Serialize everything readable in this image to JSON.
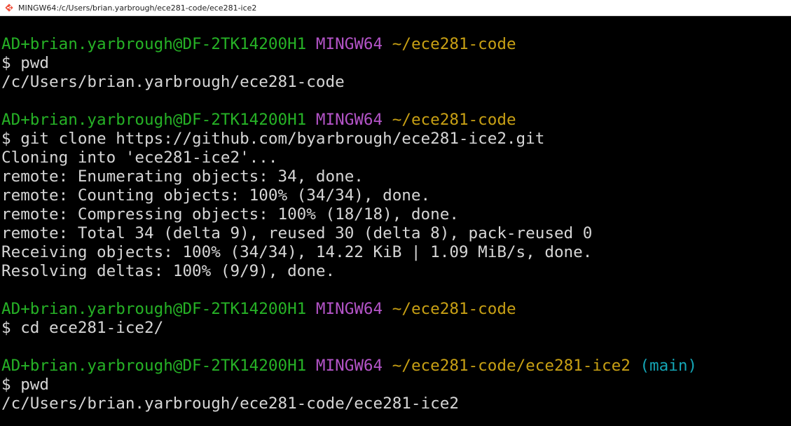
{
  "window": {
    "title": "MINGW64:/c/Users/brian.yarbrough/ece281-code/ece281-ice2",
    "icon": "git-bash-icon"
  },
  "colors": {
    "background": "#000000",
    "text": "#d6d6d6",
    "user_host": "#26b226",
    "shell": "#b454c8",
    "path": "#c8a014",
    "branch": "#14a4b4"
  },
  "terminal": {
    "blocks": [
      {
        "prompt": {
          "user_host": "AD+brian.yarbrough@DF-2TK14200H1",
          "shell": "MINGW64",
          "path": "~/ece281-code",
          "branch": ""
        },
        "command": "$ pwd",
        "output": [
          "/c/Users/brian.yarbrough/ece281-code"
        ]
      },
      {
        "prompt": {
          "user_host": "AD+brian.yarbrough@DF-2TK14200H1",
          "shell": "MINGW64",
          "path": "~/ece281-code",
          "branch": ""
        },
        "command": "$ git clone https://github.com/byarbrough/ece281-ice2.git",
        "output": [
          "Cloning into 'ece281-ice2'...",
          "remote: Enumerating objects: 34, done.",
          "remote: Counting objects: 100% (34/34), done.",
          "remote: Compressing objects: 100% (18/18), done.",
          "remote: Total 34 (delta 9), reused 30 (delta 8), pack-reused 0",
          "Receiving objects: 100% (34/34), 14.22 KiB | 1.09 MiB/s, done.",
          "Resolving deltas: 100% (9/9), done."
        ]
      },
      {
        "prompt": {
          "user_host": "AD+brian.yarbrough@DF-2TK14200H1",
          "shell": "MINGW64",
          "path": "~/ece281-code",
          "branch": ""
        },
        "command": "$ cd ece281-ice2/",
        "output": []
      },
      {
        "prompt": {
          "user_host": "AD+brian.yarbrough@DF-2TK14200H1",
          "shell": "MINGW64",
          "path": "~/ece281-code/ece281-ice2",
          "branch": "(main)"
        },
        "command": "$ pwd",
        "output": [
          "/c/Users/brian.yarbrough/ece281-code/ece281-ice2"
        ]
      }
    ]
  }
}
